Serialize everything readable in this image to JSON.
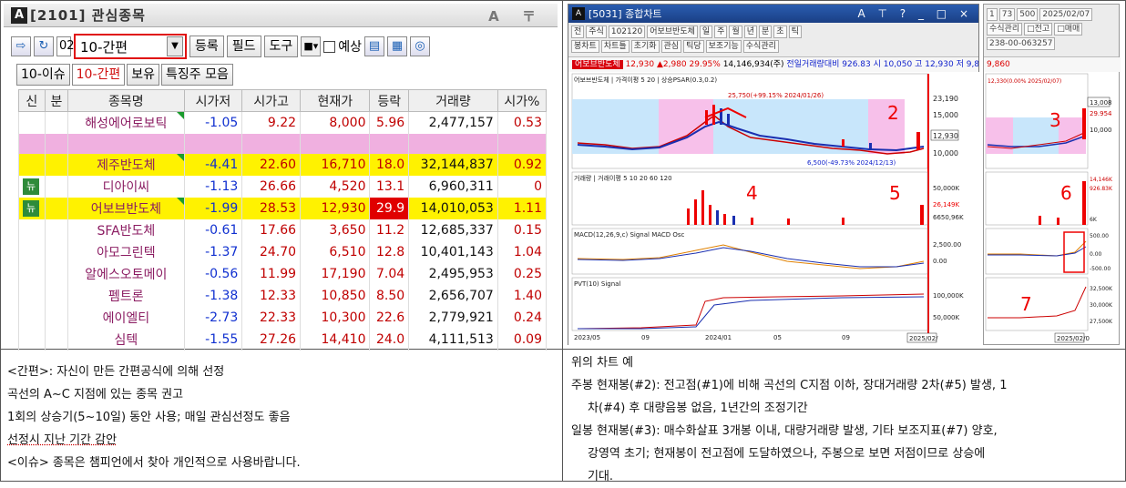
{
  "left_panel": {
    "window_logo": "A",
    "window_title": "[2101] 관심종목",
    "window_controls": "A 〒",
    "code_prefix": "02",
    "group_select": "10-간편",
    "buttons": [
      "등록",
      "필드",
      "도구"
    ],
    "preview_check_label": "예상",
    "tabs": [
      "10-이슈",
      "10-간편",
      "보유",
      "특징주 모음"
    ],
    "active_tab": "10-간편",
    "columns": [
      "신",
      "분",
      "종목명",
      "시가저",
      "시가고",
      "현재가",
      "등락",
      "거래량",
      "시가%"
    ],
    "rows": [
      {
        "new": "",
        "name": "해성에어로보틱",
        "c1": "-1.05",
        "c2": "9.22",
        "price": "8,000",
        "chg": "5.96",
        "vol": "2,477,157",
        "pct": "0.53",
        "style": "white"
      },
      {
        "new": "",
        "name": "",
        "c1": "",
        "c2": "",
        "price": "",
        "chg": "",
        "vol": "",
        "pct": "",
        "style": "pink"
      },
      {
        "new": "",
        "name": "제주반도체",
        "c1": "-4.41",
        "c2": "22.60",
        "price": "16,710",
        "chg": "18.0",
        "vol": "32,144,837",
        "pct": "0.92",
        "style": "yellow"
      },
      {
        "new": "뉴",
        "name": "디아이씨",
        "c1": "-1.13",
        "c2": "26.66",
        "price": "4,520",
        "chg": "13.1",
        "vol": "6,960,311",
        "pct": "0",
        "style": "white"
      },
      {
        "new": "뉴",
        "name": "어보브반도체",
        "c1": "-1.99",
        "c2": "28.53",
        "price": "12,930",
        "chg": "29.9",
        "vol": "14,010,053",
        "pct": "1.11",
        "style": "yellow"
      },
      {
        "new": "",
        "name": "SFA반도체",
        "c1": "-0.61",
        "c2": "17.66",
        "price": "3,650",
        "chg": "11.2",
        "vol": "12,685,337",
        "pct": "0.15",
        "style": "white"
      },
      {
        "new": "",
        "name": "아모그린텍",
        "c1": "-1.37",
        "c2": "24.70",
        "price": "6,510",
        "chg": "12.8",
        "vol": "10,401,143",
        "pct": "1.04",
        "style": "white"
      },
      {
        "new": "",
        "name": "알에스오토메이",
        "c1": "-0.56",
        "c2": "11.99",
        "price": "17,190",
        "chg": "7.04",
        "vol": "2,495,953",
        "pct": "0.25",
        "style": "white"
      },
      {
        "new": "",
        "name": "펨트론",
        "c1": "-1.38",
        "c2": "12.33",
        "price": "10,850",
        "chg": "8.50",
        "vol": "2,656,707",
        "pct": "1.40",
        "style": "white"
      },
      {
        "new": "",
        "name": "에이엘티",
        "c1": "-2.73",
        "c2": "22.33",
        "price": "10,300",
        "chg": "22.6",
        "vol": "2,779,921",
        "pct": "0.24",
        "style": "white"
      },
      {
        "new": "",
        "name": "심텍",
        "c1": "-1.55",
        "c2": "27.26",
        "price": "14,410",
        "chg": "24.0",
        "vol": "4,111,513",
        "pct": "0.09",
        "style": "white"
      }
    ]
  },
  "chart_window": {
    "title": "[5031] 종합차트",
    "stock": "어보브반도체",
    "info_price": "12,930",
    "info_change": "▲2,980",
    "info_pct": "29.95%",
    "info_volume": "14,146,934(주)",
    "info_extra": "전일거래량대비 926.83 시 10,050 고 12,930 저 9,860",
    "toolbar_row1": [
      "전",
      "주식",
      "102120",
      "어보브반도체",
      "일",
      "주",
      "월",
      "년",
      "분",
      "초",
      "틱"
    ],
    "toolbar_row2": [
      "봉차트",
      "차트틀",
      "초기화",
      "관심",
      "틱당",
      "보조기능",
      "수식관리"
    ],
    "date_box": "2025/02/",
    "high_note": "25,750(+99.15% 2024/01/26)",
    "low_note": "6,500(-49.73% 2024/12/13)",
    "legend_price": "어보브반도체 | 가격이평 5 20 | 상승PSAR(0.3,0.2)",
    "legend_vol": "거래량 | 거래이평 5 10 20 60 120",
    "legend_macd": "MACD(12,26,9,c) Signal MACD Osc",
    "legend_pvt": "PVT(10) Signal",
    "price_ticks": [
      "23,190",
      "15,000",
      "12,930",
      "10,000"
    ],
    "vol_ticks": [
      "50,000K",
      "26,149K",
      "6650,96K"
    ],
    "macd_ticks": [
      "2,500.00",
      "0.00"
    ],
    "pvt_ticks": [
      "100,000K",
      "50,000K"
    ],
    "x_ticks": [
      "2023/05",
      "09",
      "2024/01",
      "05",
      "09"
    ],
    "annotations": [
      "2",
      "4",
      "5"
    ]
  },
  "side_window": {
    "date": "2025/02/07",
    "date_box": "2025/02/0",
    "price_label": "12,330(0.00% 2025/02/07)",
    "price_ticks": [
      "13,008",
      "29.954",
      "10,000"
    ],
    "vol_ticks": [
      "14,146K",
      "926.83K",
      "6K"
    ],
    "macd_ticks": [
      "500.00",
      "0.00",
      "-500.00"
    ],
    "pvt_ticks": [
      "32,500K",
      "30,000K",
      "27,500K"
    ],
    "annotations": [
      "3",
      "6",
      "7"
    ]
  },
  "text_left": {
    "l1": "<간편>: 자신이 만든 간편공식에 의해 선정",
    "l2": "곡선의 A~C 지점에 있는 종목 권고",
    "l3": "1회의 상승기(5~10일) 동안 사용; 매일 관심선정도 좋음",
    "l4": "선정시 지난 기간 감안",
    "l5": "<이슈> 종목은 챔피언에서 찾아 개인적으로 사용바랍니다."
  },
  "text_right": {
    "l1": "위의 차트 예",
    "l2": "주봉 현재봉(#2): 전고점(#1)에 비해 곡선의 C지점 이하, 장대거래량 2차(#5) 발생, 1",
    "l3": "차(#4) 후 대량음봉 없음, 1년간의 조정기간",
    "l4": "일봉 현재봉(#3): 매수화살표 3개봉 이내, 대량거래량 발생, 기타 보조지표(#7) 양호,",
    "l5": "강영역 초기; 현재봉이 전고점에 도달하였으나, 주봉으로 보면 저점이므로 상승에",
    "l6": "기대."
  },
  "colors": {
    "highlight_yellow": "#fff200",
    "pink_row": "#f0b0e0",
    "up_red": "#c00000",
    "down_blue": "#1030d0",
    "stock_name": "#8b1c62"
  }
}
